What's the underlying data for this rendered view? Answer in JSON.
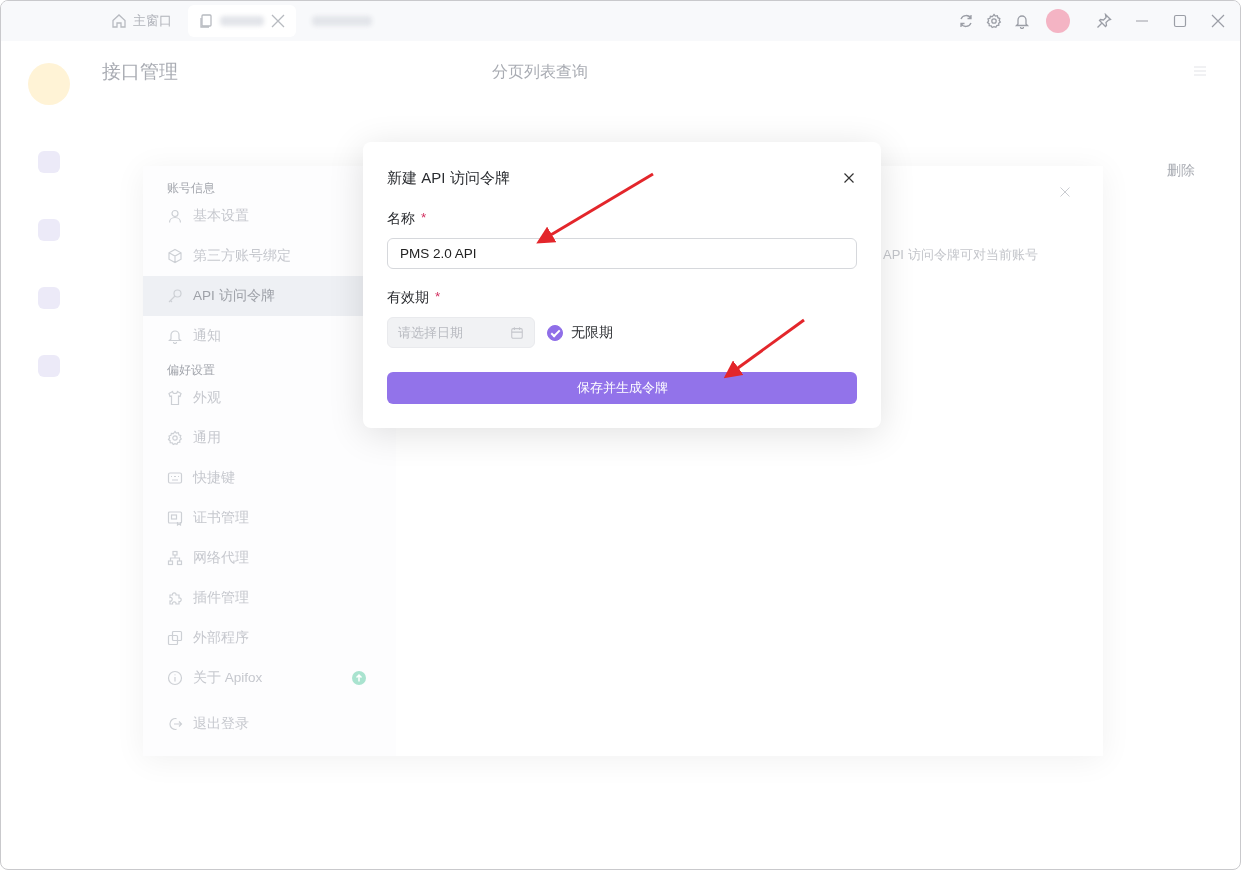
{
  "title_bar": {
    "tabs": [
      {
        "kind": "home",
        "label": "主窗口",
        "selected": false
      },
      {
        "kind": "document",
        "selected": true
      },
      {
        "kind": "blurred",
        "selected": false
      }
    ]
  },
  "app": {
    "module_title": "接口管理",
    "endpoint_title": "分页列表查询",
    "column_action": "删除"
  },
  "settings": {
    "groups": [
      {
        "title": "账号信息",
        "items": [
          {
            "kind": "user",
            "label": "基本设置",
            "selected": false
          },
          {
            "kind": "cube",
            "label": "第三方账号绑定",
            "selected": false
          },
          {
            "kind": "key",
            "label": "API 访问令牌",
            "selected": true
          },
          {
            "kind": "bell",
            "label": "通知",
            "selected": false
          }
        ]
      },
      {
        "title": "偏好设置",
        "items": [
          {
            "kind": "shirt",
            "label": "外观",
            "selected": false
          },
          {
            "kind": "gear",
            "label": "通用",
            "selected": false
          },
          {
            "kind": "keyboard",
            "label": "快捷键",
            "selected": false
          },
          {
            "kind": "certificate",
            "label": "证书管理",
            "selected": false
          },
          {
            "kind": "network",
            "label": "网络代理",
            "selected": false
          },
          {
            "kind": "puzzle",
            "label": "插件管理",
            "selected": false
          },
          {
            "kind": "windows",
            "label": "外部程序",
            "selected": false
          },
          {
            "kind": "info",
            "label": "关于 Apifox",
            "selected": false,
            "update_badge": true
          }
        ]
      },
      {
        "items": [
          {
            "kind": "logout",
            "label": "退出登录",
            "selected": false
          }
        ]
      }
    ],
    "description": "API 访问令牌可对当前账号"
  },
  "dialog": {
    "title": "新建 API 访问令牌",
    "fields": [
      {
        "kind": "text",
        "label": "名称",
        "required_mark": "*",
        "value": "PMS 2.0 API"
      },
      {
        "kind": "date",
        "label": "有效期",
        "required_mark": "*",
        "placeholder": "请选择日期",
        "disabled": true,
        "checkbox": {
          "label": "无限期",
          "checked": true
        }
      }
    ],
    "submit": "保存并生成令牌"
  }
}
